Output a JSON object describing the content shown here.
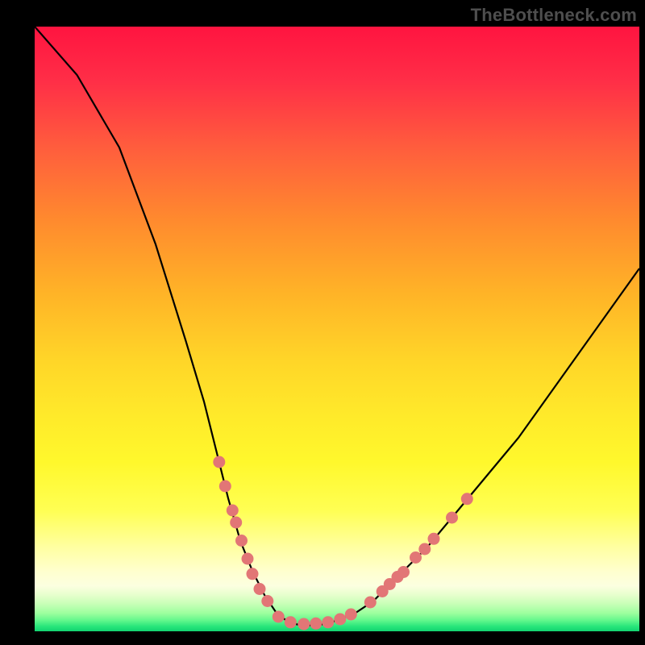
{
  "watermark": "TheBottleneck.com",
  "colors": {
    "curve": "#000000",
    "points": "#e27676",
    "frame": "#000000"
  },
  "chart_data": {
    "type": "line",
    "title": "",
    "xlabel": "",
    "ylabel": "",
    "xlim": [
      0,
      100
    ],
    "ylim": [
      0,
      100
    ],
    "grid": false,
    "legend": false,
    "curve": [
      {
        "x": 0,
        "y": 100
      },
      {
        "x": 7,
        "y": 92
      },
      {
        "x": 14,
        "y": 80
      },
      {
        "x": 20,
        "y": 64
      },
      {
        "x": 25,
        "y": 48
      },
      {
        "x": 28,
        "y": 38
      },
      {
        "x": 30,
        "y": 30
      },
      {
        "x": 32,
        "y": 22
      },
      {
        "x": 34,
        "y": 15
      },
      {
        "x": 36,
        "y": 10
      },
      {
        "x": 38,
        "y": 6
      },
      {
        "x": 40,
        "y": 3
      },
      {
        "x": 42,
        "y": 1.5
      },
      {
        "x": 44,
        "y": 1.0
      },
      {
        "x": 46,
        "y": 1.0
      },
      {
        "x": 48,
        "y": 1.2
      },
      {
        "x": 50,
        "y": 1.8
      },
      {
        "x": 53,
        "y": 3
      },
      {
        "x": 56,
        "y": 5
      },
      {
        "x": 60,
        "y": 9
      },
      {
        "x": 65,
        "y": 14
      },
      {
        "x": 70,
        "y": 20
      },
      {
        "x": 75,
        "y": 26
      },
      {
        "x": 80,
        "y": 32
      },
      {
        "x": 85,
        "y": 39
      },
      {
        "x": 90,
        "y": 46
      },
      {
        "x": 95,
        "y": 53
      },
      {
        "x": 100,
        "y": 60
      }
    ],
    "points": [
      {
        "x": 30.5,
        "y": 28
      },
      {
        "x": 31.5,
        "y": 24
      },
      {
        "x": 32.7,
        "y": 20
      },
      {
        "x": 33.3,
        "y": 18
      },
      {
        "x": 34.2,
        "y": 15
      },
      {
        "x": 35.2,
        "y": 12
      },
      {
        "x": 36.0,
        "y": 9.5
      },
      {
        "x": 37.2,
        "y": 7
      },
      {
        "x": 38.5,
        "y": 5
      },
      {
        "x": 40.3,
        "y": 2.4
      },
      {
        "x": 42.3,
        "y": 1.5
      },
      {
        "x": 44.5,
        "y": 1.2
      },
      {
        "x": 46.5,
        "y": 1.3
      },
      {
        "x": 48.5,
        "y": 1.5
      },
      {
        "x": 50.5,
        "y": 2.0
      },
      {
        "x": 52.3,
        "y": 2.8
      },
      {
        "x": 55.5,
        "y": 4.8
      },
      {
        "x": 57.5,
        "y": 6.6
      },
      {
        "x": 58.7,
        "y": 7.8
      },
      {
        "x": 60.0,
        "y": 9.0
      },
      {
        "x": 61.0,
        "y": 9.8
      },
      {
        "x": 63.0,
        "y": 12.2
      },
      {
        "x": 64.5,
        "y": 13.6
      },
      {
        "x": 66.0,
        "y": 15.3
      },
      {
        "x": 69.0,
        "y": 18.8
      },
      {
        "x": 71.5,
        "y": 21.9
      }
    ]
  }
}
